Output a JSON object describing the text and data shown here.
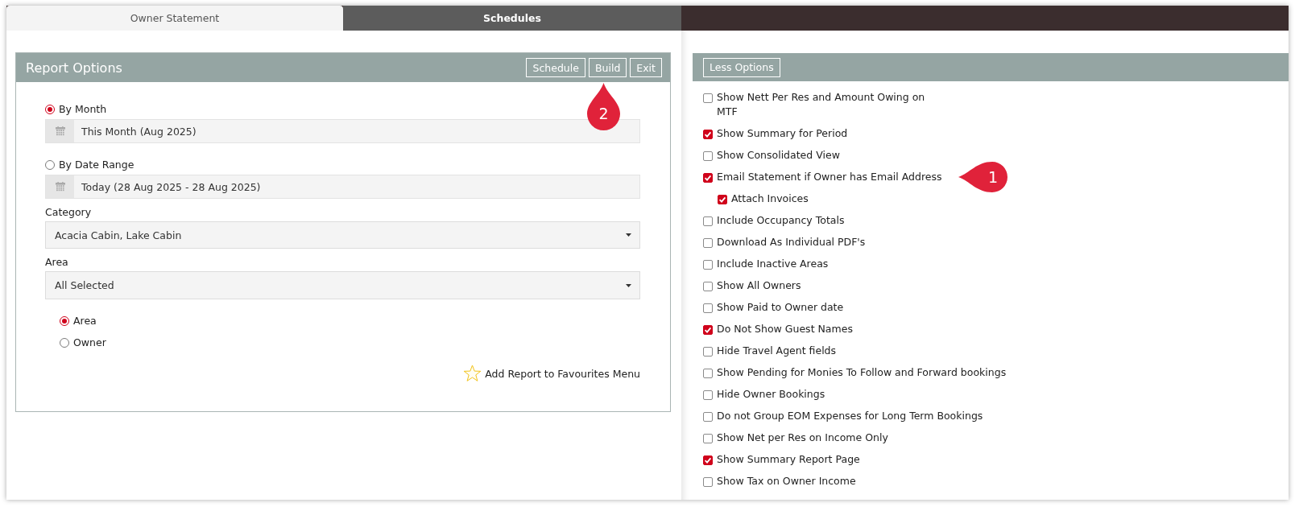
{
  "tabs": [
    {
      "label": "Owner Statement",
      "selected": true
    },
    {
      "label": "Schedules",
      "selected": false
    }
  ],
  "report_options": {
    "title": "Report Options",
    "buttons": [
      "Schedule",
      "Build",
      "Exit"
    ],
    "period_options": [
      {
        "label": "By Month",
        "selected": true,
        "value": "This Month (Aug 2025)"
      },
      {
        "label": "By Date Range",
        "selected": false,
        "value": "Today (28 Aug 2025 - 28 Aug 2025)"
      }
    ],
    "category": {
      "label": "Category",
      "value": "Acacia Cabin, Lake Cabin"
    },
    "area": {
      "label": "Area",
      "value": "All Selected"
    },
    "group_by": [
      {
        "label": "Area",
        "selected": true
      },
      {
        "label": "Owner",
        "selected": false
      }
    ],
    "favourites_link": "Add Report to Favourites Menu"
  },
  "more_options": {
    "button": "Less Options",
    "options": [
      {
        "kind": "wrapped",
        "label": "Show Nett Per Res and Amount Owing on MTF",
        "checked": false
      },
      {
        "kind": "line",
        "label": "Show Summary for Period",
        "checked": true
      },
      {
        "kind": "line",
        "label": "Show Consolidated View",
        "checked": false
      },
      {
        "kind": "line",
        "label": "Email Statement if Owner has Email Address",
        "checked": true,
        "children": [
          {
            "kind": "line",
            "label": "Attach Invoices",
            "checked": true
          }
        ]
      },
      {
        "kind": "line",
        "label": "Include Occupancy Totals",
        "checked": false
      },
      {
        "kind": "line",
        "label": "Download As Individual PDF's",
        "checked": false
      },
      {
        "kind": "line",
        "label": "Include Inactive Areas",
        "checked": false
      },
      {
        "kind": "line",
        "label": "Show All Owners",
        "checked": false
      },
      {
        "kind": "line",
        "label": "Show Paid to Owner date",
        "checked": false
      },
      {
        "kind": "line",
        "label": "Do Not Show Guest Names",
        "checked": true
      },
      {
        "kind": "line",
        "label": "Hide Travel Agent fields",
        "checked": false
      },
      {
        "kind": "line",
        "label": "Show Pending for Monies To Follow and Forward bookings",
        "checked": false
      },
      {
        "kind": "line",
        "label": "Hide Owner Bookings",
        "checked": false
      },
      {
        "kind": "line",
        "label": "Do not Group EOM Expenses for Long Term Bookings",
        "checked": false
      },
      {
        "kind": "line",
        "label": "Show Net per Res on Income Only",
        "checked": false
      },
      {
        "kind": "line",
        "label": "Show Summary Report Page",
        "checked": true
      },
      {
        "kind": "line",
        "label": "Show Tax on Owner Income",
        "checked": false
      }
    ]
  },
  "callouts": [
    {
      "label": "2",
      "kind": "up"
    },
    {
      "label": "1",
      "kind": "left"
    }
  ]
}
